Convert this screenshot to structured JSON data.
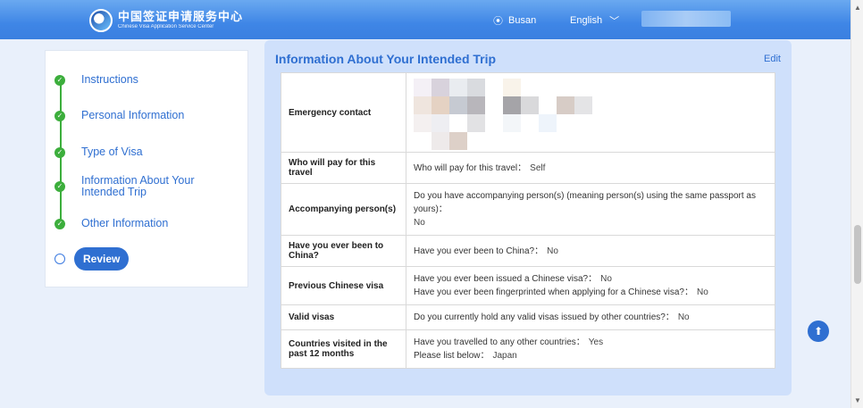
{
  "header": {
    "logo_cn": "中国签证申请服务中心",
    "logo_en": "Chinese Visa Application Service Center",
    "location": "Busan",
    "language": "English"
  },
  "sidebar": {
    "items": [
      {
        "label": "Instructions",
        "state": "done"
      },
      {
        "label": "Personal Information",
        "state": "done"
      },
      {
        "label": "Type of Visa",
        "state": "done"
      },
      {
        "label": "Information About Your Intended Trip",
        "state": "done"
      },
      {
        "label": "Other Information",
        "state": "done"
      },
      {
        "label": "Review",
        "state": "current"
      }
    ]
  },
  "main": {
    "title": "Information About Your Intended Trip",
    "edit": "Edit",
    "rows": [
      {
        "key": "Emergency contact"
      },
      {
        "key": "Who will pay for this travel",
        "q1": "Who will pay for this travel：",
        "a1": "Self"
      },
      {
        "key": "Accompanying person(s)",
        "q1": "Do you have accompanying person(s) (meaning person(s) using the same passport as yours)：",
        "a1": "No"
      },
      {
        "key": "Have you ever been to China?",
        "q1": "Have you ever been to China?：",
        "a1": "No"
      },
      {
        "key": "Previous Chinese visa",
        "q1": "Have you ever been issued a Chinese visa?：",
        "a1": "No",
        "q2": "Have you ever been fingerprinted when applying for a Chinese visa?：",
        "a2": "No"
      },
      {
        "key": "Valid visas",
        "q1": "Do you currently hold any valid visas issued by other countries?：",
        "a1": "No"
      },
      {
        "key": "Countries visited in the past 12 months",
        "q1": "Have you travelled to any other countries：",
        "a1": "Yes",
        "q2": "Please list below：",
        "a2": "Japan"
      }
    ]
  },
  "colors": {
    "accent": "#2f6fd1",
    "done": "#3cae3c",
    "card": "#cfe0fb"
  },
  "icons": {
    "location": "location-pin-icon",
    "language": "chevron-down-icon",
    "scroll_top": "arrow-up-icon"
  }
}
